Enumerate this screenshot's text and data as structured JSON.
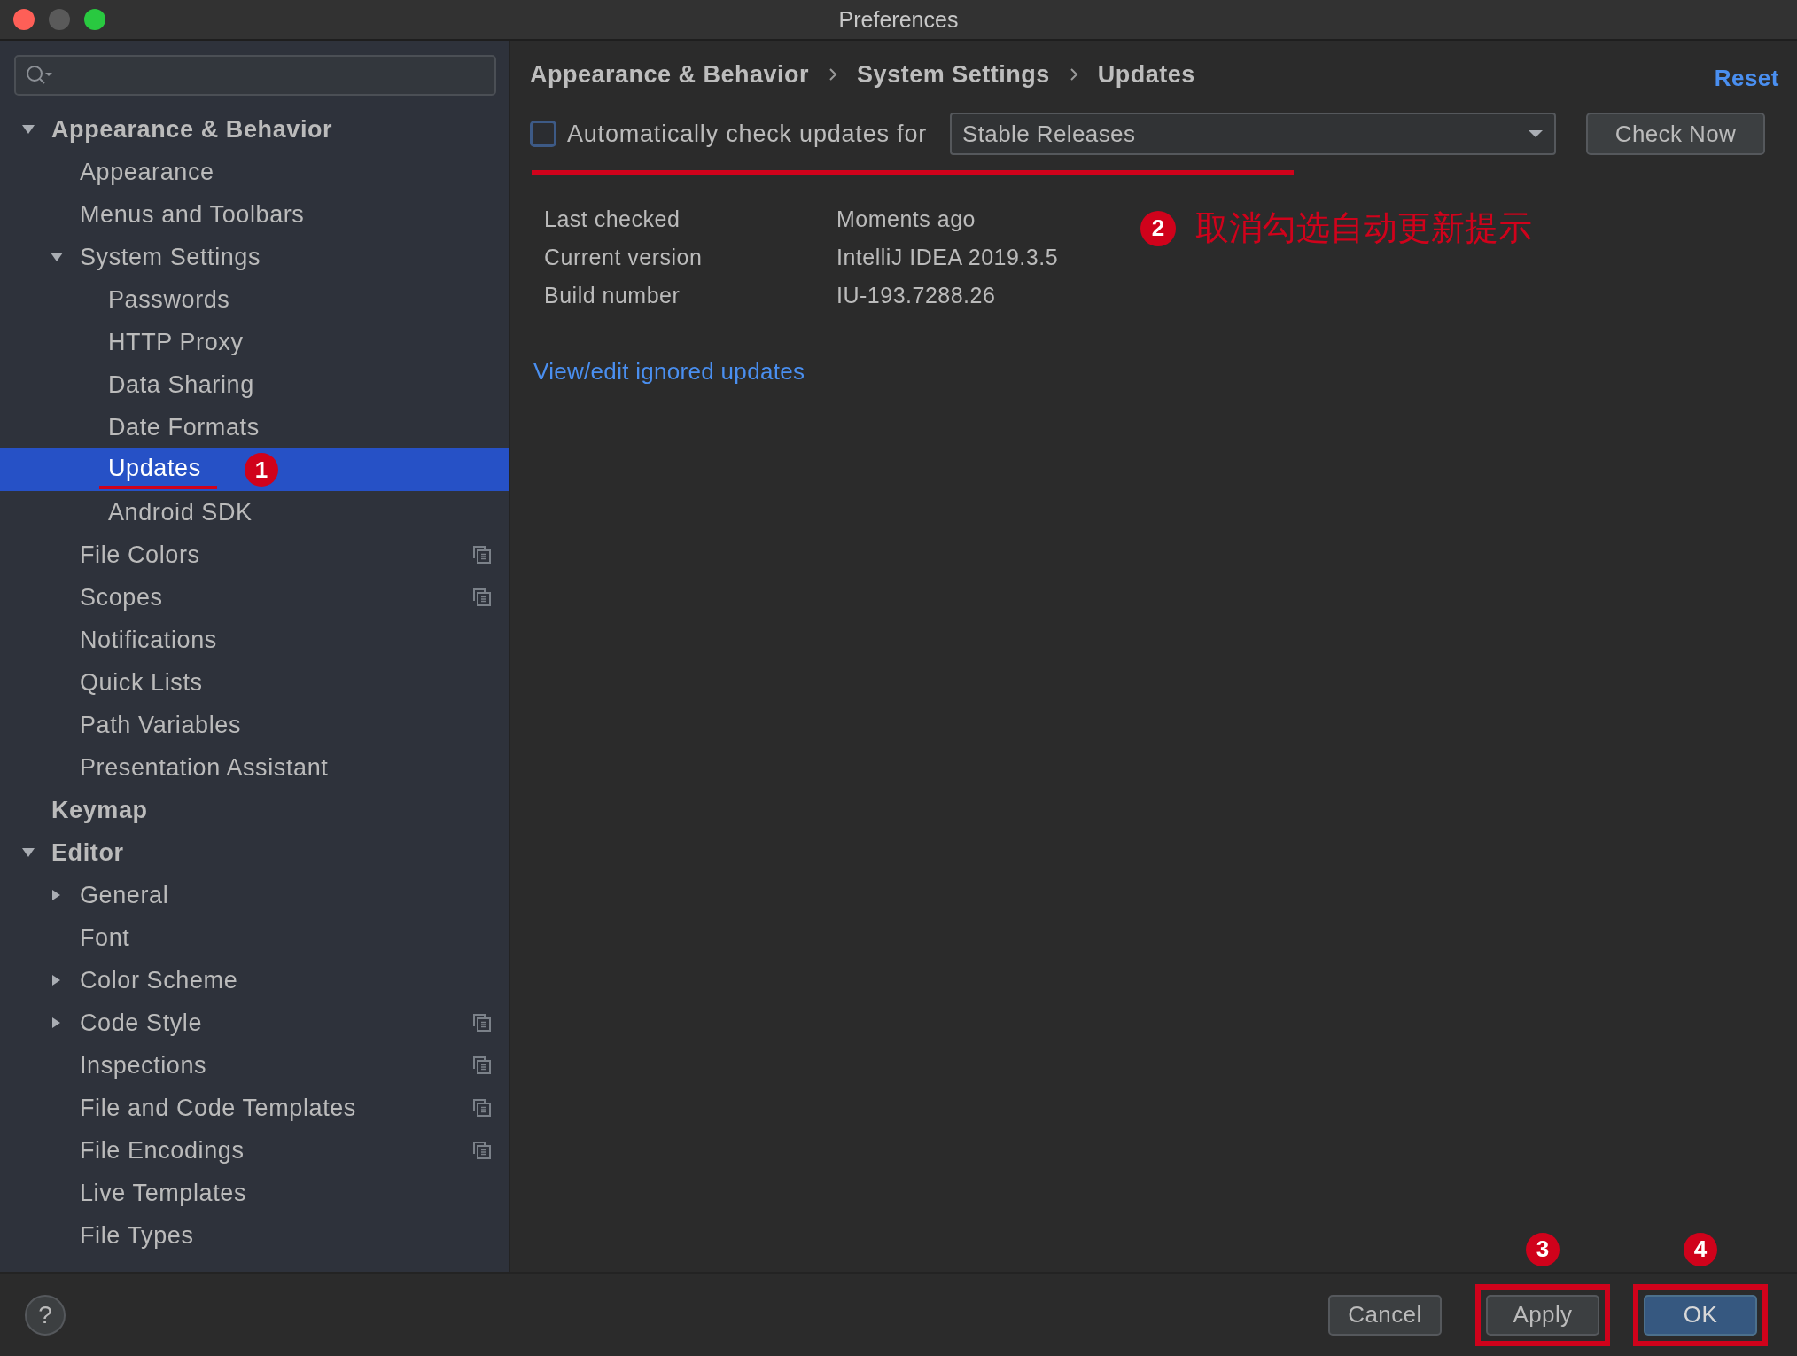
{
  "window": {
    "title": "Preferences"
  },
  "sidebar": {
    "items": [
      {
        "label": "Appearance & Behavior",
        "selected": false,
        "expanded": true,
        "children": [
          {
            "label": "Appearance",
            "selected": false
          },
          {
            "label": "Menus and Toolbars",
            "selected": false
          },
          {
            "label": "System Settings",
            "selected": false,
            "expanded": true,
            "children": [
              {
                "label": "Passwords",
                "selected": false
              },
              {
                "label": "HTTP Proxy",
                "selected": false
              },
              {
                "label": "Data Sharing",
                "selected": false
              },
              {
                "label": "Date Formats",
                "selected": false
              },
              {
                "label": "Updates",
                "selected": true,
                "underlined": true,
                "marker": "1"
              },
              {
                "label": "Android SDK",
                "selected": false
              }
            ]
          },
          {
            "label": "File Colors",
            "selected": false,
            "project_icon": true
          },
          {
            "label": "Scopes",
            "selected": false,
            "project_icon": true
          },
          {
            "label": "Notifications",
            "selected": false
          },
          {
            "label": "Quick Lists",
            "selected": false
          },
          {
            "label": "Path Variables",
            "selected": false
          },
          {
            "label": "Presentation Assistant",
            "selected": false
          }
        ]
      },
      {
        "label": "Keymap",
        "selected": false
      },
      {
        "label": "Editor",
        "selected": false,
        "expanded": true,
        "children": [
          {
            "label": "General",
            "selected": false,
            "expanded": false
          },
          {
            "label": "Font",
            "selected": false
          },
          {
            "label": "Color Scheme",
            "selected": false,
            "expanded": false
          },
          {
            "label": "Code Style",
            "selected": false,
            "expanded": false,
            "project_icon": true
          },
          {
            "label": "Inspections",
            "selected": false,
            "project_icon": true
          },
          {
            "label": "File and Code Templates",
            "selected": false,
            "project_icon": true
          },
          {
            "label": "File Encodings",
            "selected": false,
            "project_icon": true
          },
          {
            "label": "Live Templates",
            "selected": false
          },
          {
            "label": "File Types",
            "selected": false
          }
        ]
      }
    ]
  },
  "breadcrumb": [
    "Appearance & Behavior",
    "System Settings",
    "Updates"
  ],
  "reset_link": "Reset",
  "auto_check": {
    "label": "Automatically check updates for",
    "checked": false,
    "dropdown": "Stable Releases",
    "underlined": true,
    "marker": "2",
    "note": "取消勾选自动更新提示"
  },
  "check_now_button": "Check Now",
  "info": [
    {
      "label": "Last checked",
      "value": "Moments ago"
    },
    {
      "label": "Current version",
      "value": "IntelliJ IDEA 2019.3.5"
    },
    {
      "label": "Build number",
      "value": "IU-193.7288.26"
    }
  ],
  "ignored_updates_link": "View/edit ignored updates",
  "footer": {
    "help": "?",
    "buttons": [
      {
        "label": "Cancel",
        "default": false,
        "boxed": false
      },
      {
        "label": "Apply",
        "default": false,
        "boxed": true,
        "marker": "3"
      },
      {
        "label": "OK",
        "default": true,
        "boxed": true,
        "marker": "4"
      }
    ]
  }
}
